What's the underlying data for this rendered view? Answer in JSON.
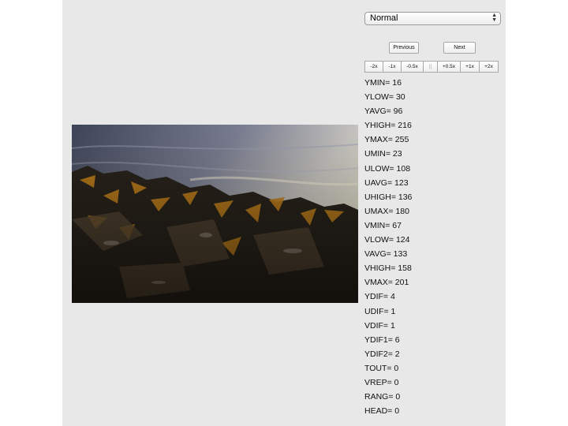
{
  "mode_select": {
    "value": "Normal"
  },
  "nav": {
    "previous_label": "Previous",
    "next_label": "Next"
  },
  "speed_buttons": [
    {
      "label": "-2x"
    },
    {
      "label": "-1x"
    },
    {
      "label": "-0.5x"
    },
    {
      "label": "||"
    },
    {
      "label": "+0.5x"
    },
    {
      "label": "+1x"
    },
    {
      "label": "+2x"
    }
  ],
  "stats": [
    "YMIN= 16",
    "YLOW= 30",
    "YAVG= 96",
    "YHIGH= 216",
    "YMAX= 255",
    "UMIN= 23",
    "ULOW= 108",
    "UAVG= 123",
    "UHIGH= 136",
    "UMAX= 180",
    "VMIN= 67",
    "VLOW= 124",
    "VAVG= 133",
    "VHIGH= 158",
    "VMAX= 201",
    "YDIF= 4",
    "UDIF= 1",
    "VDIF= 1",
    "YDIF1= 6",
    "YDIF2= 2",
    "TOUT= 0",
    "VREP= 0",
    "RANG= 0",
    "HEAD= 0"
  ],
  "colors": {
    "panel_bg": "#e8e8e8",
    "water_dark": "#4a5068",
    "water_light": "#e8e6d8",
    "seaweed_dark": "#2a241c",
    "seaweed_orange": "#c8841c"
  }
}
